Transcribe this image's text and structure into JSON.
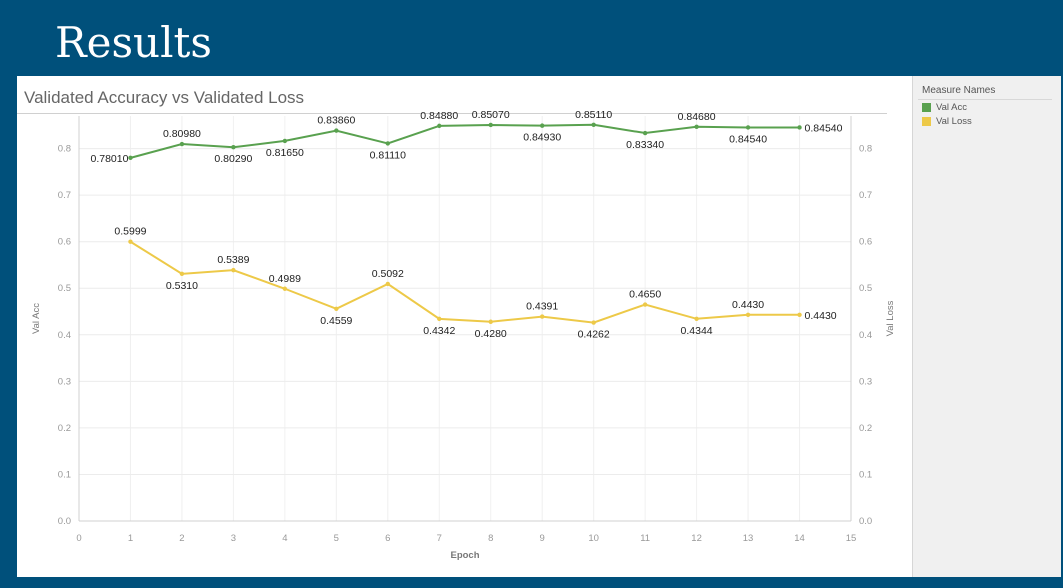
{
  "slide": {
    "title": "Results"
  },
  "chart_data": {
    "type": "line",
    "title": "Validated Accuracy vs Validated Loss",
    "xlabel": "Epoch",
    "ylabel_left": "Val Acc",
    "ylabel_right": "Val Loss",
    "x": [
      1,
      2,
      3,
      4,
      5,
      6,
      7,
      8,
      9,
      10,
      11,
      12,
      13,
      14
    ],
    "xlim": [
      0,
      15
    ],
    "xticks": [
      "0",
      "1",
      "2",
      "3",
      "4",
      "5",
      "6",
      "7",
      "8",
      "9",
      "10",
      "11",
      "12",
      "13",
      "14",
      "15"
    ],
    "ylim": [
      0,
      0.87
    ],
    "yticks": [
      "0.0",
      "0.1",
      "0.2",
      "0.3",
      "0.4",
      "0.5",
      "0.6",
      "0.7",
      "0.8"
    ],
    "grid": true,
    "legend_title": "Measure Names",
    "legend_position": "right",
    "series": [
      {
        "name": "Val Acc",
        "color": "#59a14f",
        "values": [
          0.7801,
          0.8098,
          0.8029,
          0.8165,
          0.8386,
          0.8111,
          0.8488,
          0.8507,
          0.8493,
          0.8511,
          0.8334,
          0.8468,
          0.8454,
          0.8454
        ],
        "labels": [
          "0.78010",
          "0.80980",
          "0.80290",
          "0.81650",
          "0.83860",
          "0.81110",
          "0.84880",
          "0.85070",
          "0.84930",
          "0.85110",
          "0.83340",
          "0.84680",
          "0.84540",
          "0.84540"
        ],
        "label_pos": [
          "left",
          "above",
          "below",
          "below",
          "above",
          "below",
          "above",
          "above",
          "below",
          "above",
          "below",
          "above",
          "below",
          "right"
        ]
      },
      {
        "name": "Val Loss",
        "color": "#edc948",
        "values": [
          0.5999,
          0.531,
          0.5389,
          0.4989,
          0.4559,
          0.5092,
          0.4342,
          0.428,
          0.4391,
          0.4262,
          0.465,
          0.4344,
          0.443,
          0.443
        ],
        "labels": [
          "0.5999",
          "0.5310",
          "0.5389",
          "0.4989",
          "0.4559",
          "0.5092",
          "0.4342",
          "0.4280",
          "0.4391",
          "0.4262",
          "0.4650",
          "0.4344",
          "0.4430",
          "0.4430"
        ],
        "label_pos": [
          "above",
          "below",
          "above",
          "above",
          "below",
          "above",
          "below",
          "below",
          "above",
          "below",
          "above",
          "below",
          "above",
          "right"
        ]
      }
    ]
  }
}
